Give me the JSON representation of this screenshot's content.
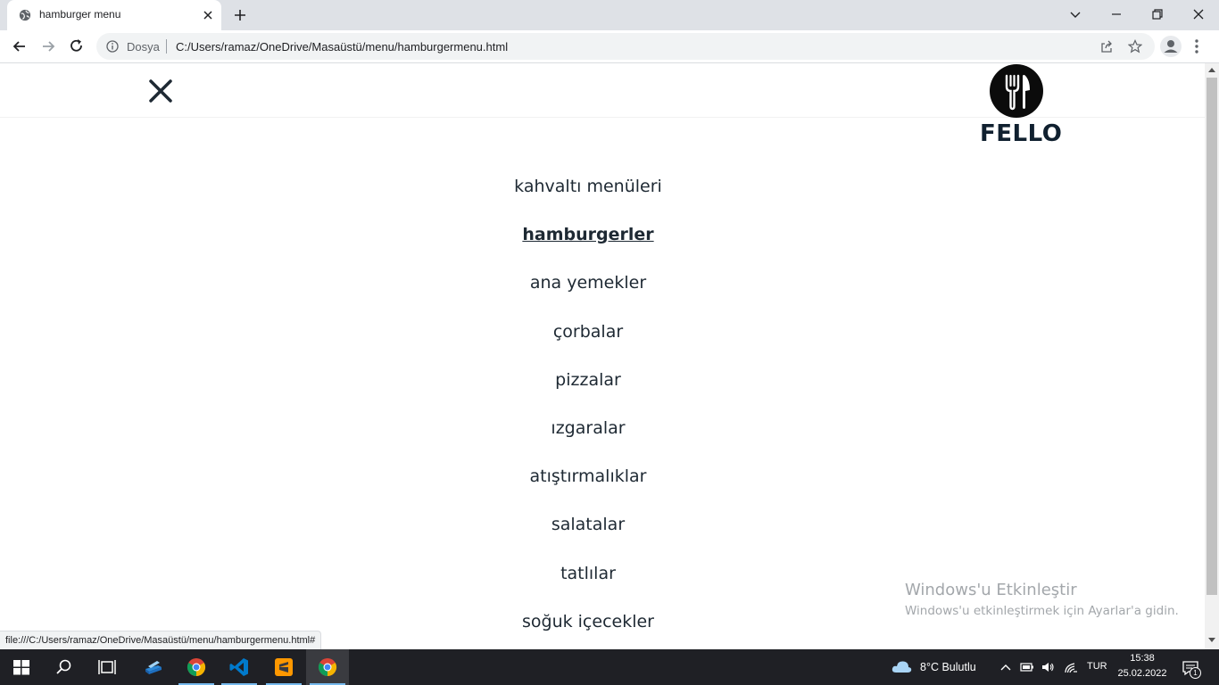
{
  "browser": {
    "tab_title": "hamburger menu",
    "scheme_label": "Dosya",
    "url": "C:/Users/ramaz/OneDrive/Masaüstü/menu/hamburgermenu.html",
    "status_url": "file:///C:/Users/ramaz/OneDrive/Masaüstü/menu/hamburgermenu.html#"
  },
  "site": {
    "logo_text": "FELLO",
    "menu_items": [
      "kahvaltı menüleri",
      "hamburgerler",
      "ana yemekler",
      "çorbalar",
      "pizzalar",
      "ızgaralar",
      "atıştırmalıklar",
      "salatalar",
      "tatlılar",
      "soğuk içecekler"
    ],
    "active_item": "hamburgerler"
  },
  "watermark": {
    "title": "Windows'u Etkinleştir",
    "subtitle": "Windows'u etkinleştirmek için Ayarlar'a gidin."
  },
  "taskbar": {
    "weather": "8°C  Bulutlu",
    "language": "TUR",
    "time": "15:38",
    "date": "25.02.2022",
    "notification_count": "1"
  },
  "colors": {
    "text_dark": "#1e2933",
    "logo_dark": "#10202f",
    "chrome_bg": "#dee1e6",
    "taskbar_bg": "#1f2025",
    "accent": "#76b9ed"
  },
  "icons": {
    "tab": "globe-icon",
    "nav": [
      "back-arrow-icon",
      "forward-arrow-icon",
      "reload-icon"
    ],
    "close_menu": "close-x-icon",
    "logo": "fork-knife-icon"
  }
}
